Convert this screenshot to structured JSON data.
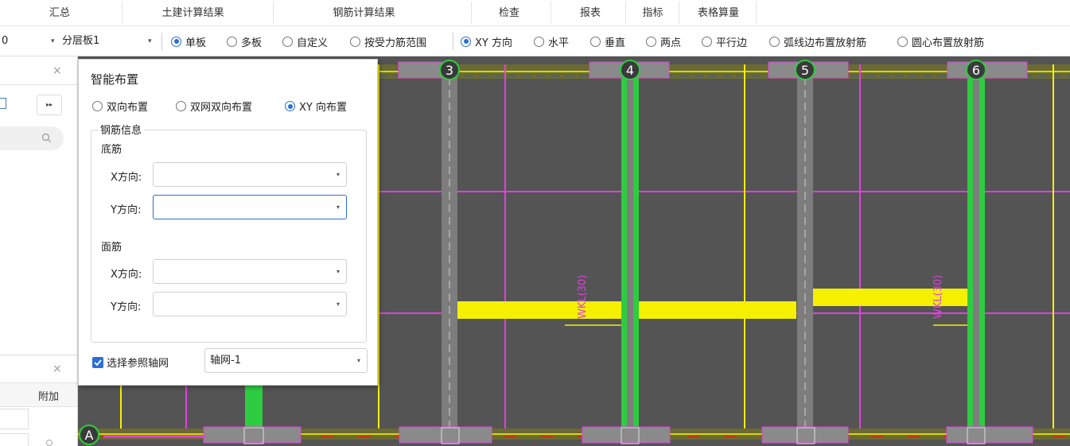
{
  "ribbon": {
    "tabs": [
      {
        "label": "汇总"
      },
      {
        "label": "土建计算结果"
      },
      {
        "label": "钢筋计算结果"
      },
      {
        "label": "检查"
      },
      {
        "label": "报表"
      },
      {
        "label": "指标"
      },
      {
        "label": "表格算量"
      }
    ]
  },
  "toolbar": {
    "partial_value": "0",
    "layer_select": "分层板1",
    "radios_a": [
      {
        "label": "单板",
        "checked": true
      },
      {
        "label": "多板",
        "checked": false
      },
      {
        "label": "自定义",
        "checked": false
      },
      {
        "label": "按受力筋范围",
        "checked": false
      }
    ],
    "radios_b": [
      {
        "label": "XY 方向",
        "checked": true
      },
      {
        "label": "水平",
        "checked": false
      },
      {
        "label": "垂直",
        "checked": false
      },
      {
        "label": "两点",
        "checked": false
      },
      {
        "label": "平行边",
        "checked": false
      },
      {
        "label": "弧线边布置放射筋",
        "checked": false
      },
      {
        "label": "圆心布置放射筋",
        "checked": false
      }
    ]
  },
  "left_panel": {
    "close_glyph": "×",
    "more_glyph": "▸▸",
    "column_header": "附加"
  },
  "dialog": {
    "title": "智能布置",
    "modes": [
      {
        "label": "双向布置",
        "checked": false
      },
      {
        "label": "双网双向布置",
        "checked": false
      },
      {
        "label": "XY 向布置",
        "checked": true
      }
    ],
    "group_title": "钢筋信息",
    "bottom_label": "底筋",
    "top_label": "面筋",
    "x_label": "X方向:",
    "y_label": "Y方向:",
    "bottom_x": "",
    "bottom_y": "",
    "top_x": "",
    "top_y": "",
    "axis_check_label": "选择参照轴网",
    "axis_check_checked": true,
    "axis_value": "轴网-1"
  },
  "canvas": {
    "axis_labels": [
      "3",
      "4",
      "5",
      "6"
    ],
    "row_label": "A",
    "beam_tags": [
      "WKL(30)",
      "WKL(30)"
    ],
    "colors": {
      "background": "#545454",
      "beam_gray": "#7d7d7d",
      "magenta": "#e040e0",
      "yellow": "#f4f000",
      "green": "#2ecc40",
      "accent": "#2b6fd6"
    }
  }
}
